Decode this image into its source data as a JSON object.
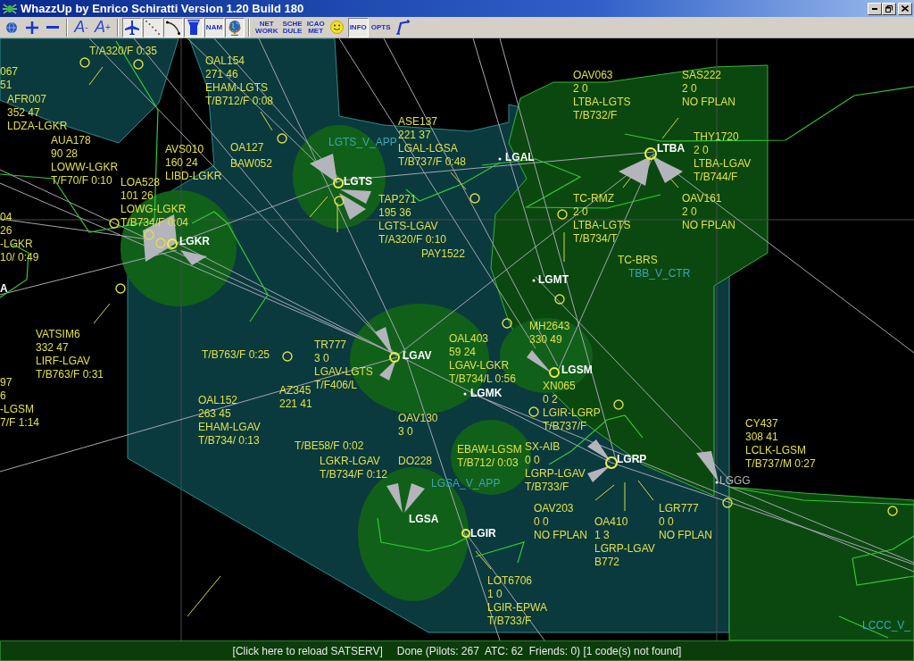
{
  "window": {
    "title": "WhazzUp by Enrico Schiratti Version 1.20 Build 180"
  },
  "toolbar": [
    {
      "kind": "icon",
      "pressed": false
    },
    {
      "kind": "icon",
      "pressed": false
    },
    {
      "kind": "icon",
      "pressed": false
    },
    {
      "kind": "separator"
    },
    {
      "kind": "glyph",
      "label": "A$^{-}$",
      "pressed": false
    },
    {
      "kind": "glyph",
      "label": "A$^{+}$",
      "pressed": false
    },
    {
      "kind": "separator"
    },
    {
      "kind": "icon",
      "pressed": true
    },
    {
      "kind": "icon",
      "pressed": true
    },
    {
      "kind": "icon",
      "pressed": true
    },
    {
      "kind": "icon",
      "pressed": true
    },
    {
      "kind": "text",
      "label": "NAM",
      "pressed": true
    },
    {
      "kind": "icon",
      "pressed": true
    },
    {
      "kind": "separator"
    },
    {
      "kind": "text",
      "label": "NET WORK",
      "pressed": false
    },
    {
      "kind": "text",
      "label": "SCHE DULE",
      "pressed": false
    },
    {
      "kind": "text",
      "label": "ICAO MET",
      "pressed": false
    },
    {
      "kind": "icon",
      "pressed": false
    },
    {
      "kind": "text",
      "label": "INFO",
      "pressed": true
    },
    {
      "kind": "text",
      "label": "OPTS",
      "pressed": false
    },
    {
      "kind": "icon",
      "pressed": false
    }
  ],
  "map": {
    "flights": [
      {
        "lines": [
          "T/A320/F 0:35"
        ]
      },
      {
        "lines": [
          "067",
          "51"
        ]
      },
      {
        "lines": [
          "AFR007",
          "352 47",
          "LDZA-LGKR"
        ]
      },
      {
        "lines": [
          "OAL154",
          "271 46",
          "EHAM-LGTS",
          "T/B712/F 0:08"
        ]
      },
      {
        "lines": [
          "OAV063",
          "2 0",
          "LTBA-LGTS",
          "T/B732/F"
        ]
      },
      {
        "lines": [
          "SAS222",
          "2 0",
          "NO FPLAN"
        ]
      },
      {
        "lines": [
          "AUA178",
          "90 28",
          "LOWW-LGKR",
          "T/F70/F 0:10"
        ]
      },
      {
        "lines": [
          "AVS010",
          "160 24",
          "LIBD-LGKR"
        ]
      },
      {
        "lines": [
          "OA127"
        ]
      },
      {
        "lines": [
          "BAW052"
        ]
      },
      {
        "lines": [
          "ASE137",
          "221 37",
          "LGAL-LGSA",
          "T/B737/F 0:48"
        ]
      },
      {
        "lines": [
          "THY1720",
          "2 0",
          "LTBA-LGAV",
          "T/B744/F"
        ]
      },
      {
        "lines": [
          "04",
          "26",
          "-LGKR",
          "10/ 0:49"
        ]
      },
      {
        "lines": [
          "LOA528",
          "101 26",
          "LOWG-LGKR",
          "T/B734/F 0:04"
        ]
      },
      {
        "lines": [
          "TAP271",
          "195 36",
          "LGTS-LGAV",
          "T/A320/F 0:10"
        ]
      },
      {
        "lines": [
          "TC-RMZ",
          "2 0",
          "LTBA-LGTS",
          "T/B734/T"
        ]
      },
      {
        "lines": [
          "OAV161",
          "2 0",
          "NO FPLAN"
        ]
      },
      {
        "lines": [
          "PAY1522"
        ]
      },
      {
        "lines": [
          "TC-BRS"
        ]
      },
      {
        "lines": [
          "VATSIM6",
          "332 47",
          "LIRF-LGAV",
          "T/B763/F 0:31"
        ]
      },
      {
        "lines": [
          "T/B763/F 0:25"
        ]
      },
      {
        "lines": [
          "TR777",
          "3 0",
          "LGAV-LGTS",
          "T/F406/L"
        ]
      },
      {
        "lines": [
          "OAL403",
          "59 24",
          "LGAV-LGKR",
          "T/B734/L 0:56"
        ]
      },
      {
        "lines": [
          "MH2643",
          "330 49"
        ]
      },
      {
        "lines": [
          "97",
          "6",
          "-LGSM",
          "7/F 1:14"
        ]
      },
      {
        "lines": [
          "OAL152",
          "263 45",
          "EHAM-LGAV",
          "T/B734/ 0:13"
        ]
      },
      {
        "lines": [
          "AZ345",
          "221 41"
        ]
      },
      {
        "lines": [
          "OAV130",
          "3 0"
        ]
      },
      {
        "lines": [
          "XN065",
          "0 2",
          "LGIR-LGRP",
          "T/B737/F"
        ]
      },
      {
        "lines": [
          "T/BE58/F 0:02"
        ]
      },
      {
        "lines": [
          "LGKR-LGAV",
          "T/B734/F 0:12"
        ]
      },
      {
        "lines": [
          "DO228"
        ]
      },
      {
        "lines": [
          "EBAW-LGSM",
          "T/B712/ 0:03"
        ]
      },
      {
        "lines": [
          "SX-AIB",
          "0 0",
          "LGRP-LGAV",
          "T/B733/F"
        ]
      },
      {
        "lines": [
          "CY437",
          "308 41",
          "LCLK-LGSM",
          "T/B737/M 0:27"
        ]
      },
      {
        "lines": [
          "OAV203",
          "0 0",
          "NO FPLAN"
        ]
      },
      {
        "lines": [
          "OA410",
          "1 3",
          "LGRP-LGAV",
          "B772"
        ]
      },
      {
        "lines": [
          "LGR777",
          "0 0",
          "NO FPLAN"
        ]
      },
      {
        "lines": [
          "LOT6706",
          "1 0",
          "LGIR-EPWA",
          "T/B733/F"
        ]
      }
    ],
    "airports": [
      {
        "code": "LGAL",
        "dimmed": false
      },
      {
        "code": "LTBA",
        "dimmed": false
      },
      {
        "code": "LGTS",
        "dimmed": false
      },
      {
        "code": "LGKR",
        "dimmed": false
      },
      {
        "code": "A",
        "dimmed": false
      },
      {
        "code": "LGMT",
        "dimmed": false
      },
      {
        "code": "LGAV",
        "dimmed": false
      },
      {
        "code": "LGSM",
        "dimmed": false
      },
      {
        "code": "LGMK",
        "dimmed": false
      },
      {
        "code": "LGRP",
        "dimmed": false
      },
      {
        "code": "LGGG",
        "dimmed": true
      },
      {
        "code": "LGSA",
        "dimmed": false
      },
      {
        "code": "LGIR",
        "dimmed": false
      }
    ],
    "atc": [
      {
        "label": "LGTS_V_APP"
      },
      {
        "label": "TBB_V_CTR"
      },
      {
        "label": "LGSA_V_APP"
      },
      {
        "label": "LCCC_V_"
      }
    ]
  },
  "status_bar": {
    "reload_link": "[Click here to reload SATSERV]",
    "status": "Done (Pilots: 267  ATC: 62  Friends: 0) [1 code(s) not found]"
  }
}
